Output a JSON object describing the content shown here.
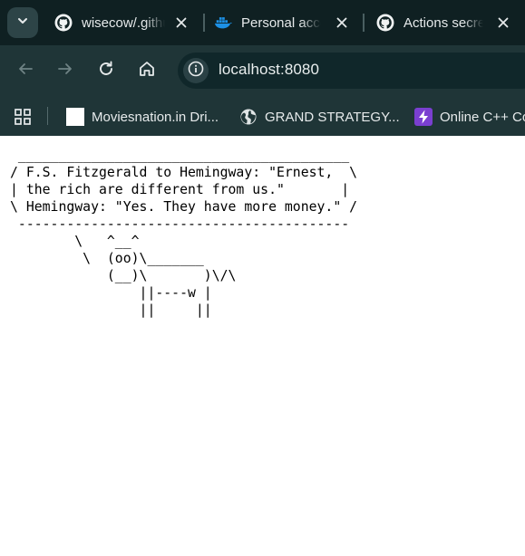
{
  "tabs": [
    {
      "title": "wisecow/.github",
      "icon": "github-icon"
    },
    {
      "title": "Personal access",
      "icon": "docker-icon"
    },
    {
      "title": "Actions secrets",
      "icon": "github-icon"
    }
  ],
  "toolbar": {
    "url": "localhost:8080"
  },
  "bookmarks": [
    {
      "label": "Moviesnation.in Dri...",
      "icon": "blank-page-icon"
    },
    {
      "label": "GRAND STRATEGY...",
      "icon": "globe-icon"
    },
    {
      "label": "Online C++ Co",
      "icon": "bolt-icon"
    }
  ],
  "page": {
    "cowsay": " _________________________________________\n/ F.S. Fitzgerald to Hemingway: \"Ernest,  \\\n| the rich are different from us.\"       |\n\\ Hemingway: \"Yes. They have more money.\" /\n -----------------------------------------\n        \\   ^__^\n         \\  (oo)\\_______\n            (__)\\       )\\/\\\n                ||----w |\n                ||     ||"
  },
  "colors": {
    "tab_strip_bg": "#0f2022",
    "toolbar_bg": "#1f3537",
    "omnibox_bg": "#10272a",
    "docker_blue": "#1d91e6",
    "bolt_purple": "#7a3fd0"
  }
}
